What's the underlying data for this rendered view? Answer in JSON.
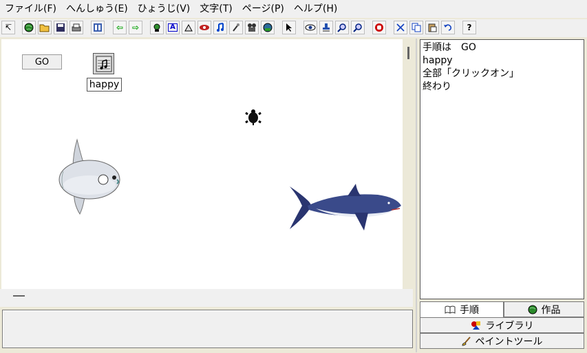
{
  "menu": [
    "ファイル(F)",
    "へんしゅう(E)",
    "ひょうじ(V)",
    "文字(T)",
    "ページ(P)",
    "ヘルプ(H)"
  ],
  "toolbar": {
    "arrow_glyph": "↸",
    "back_glyph": "⇦",
    "forward_glyph": "⇨",
    "text_tool_glyph": "A",
    "help_glyph": "?"
  },
  "stage": {
    "go_button_label": "GO",
    "music_button_label": "happy"
  },
  "script": {
    "lines": [
      "手順は　GO",
      "happy",
      "全部「クリックオン」",
      "終わり"
    ]
  },
  "tabs": {
    "steps": "手順",
    "works": "作品",
    "library": "ライブラリ",
    "paint_tools": "ペイントツール"
  },
  "colors": {
    "accent_green": "#00a000",
    "accent_blue": "#0044cc",
    "stop_red": "#cc0000"
  }
}
